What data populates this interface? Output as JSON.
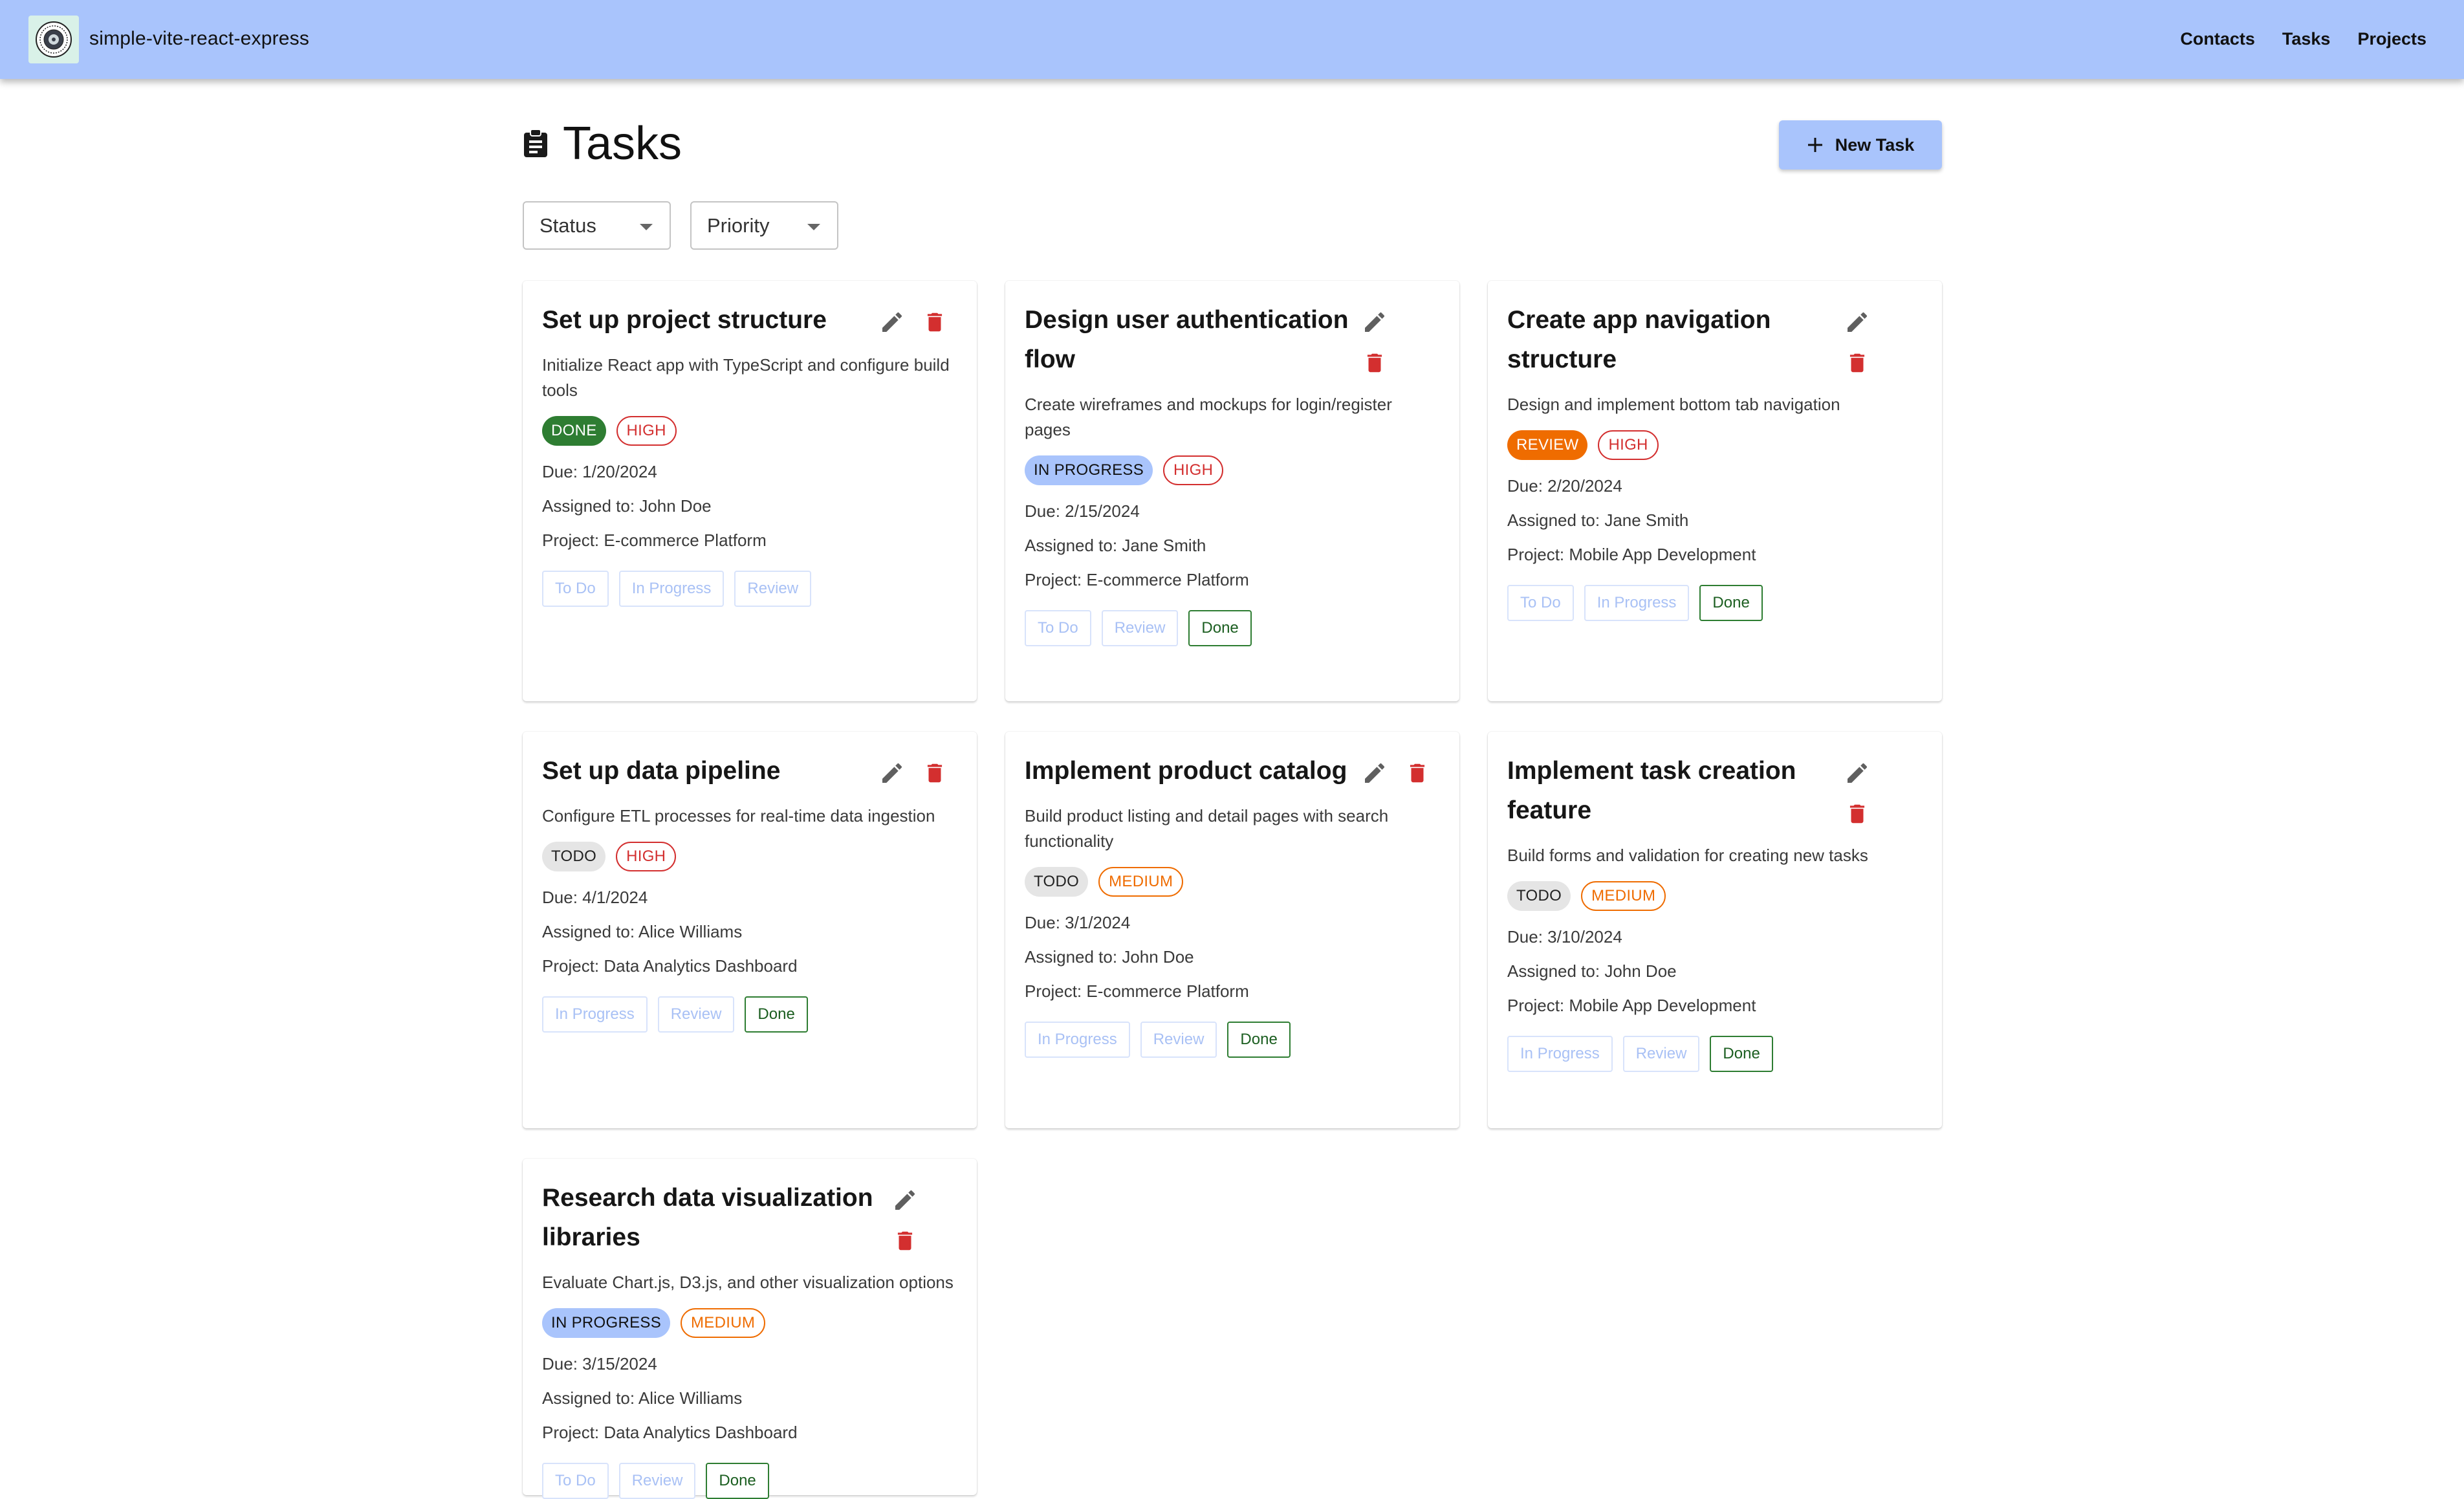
{
  "app": {
    "title": "simple-vite-react-express",
    "logo_icon": "seal-logo"
  },
  "nav": [
    {
      "label": "Contacts"
    },
    {
      "label": "Tasks"
    },
    {
      "label": "Projects"
    }
  ],
  "page": {
    "title": "Tasks",
    "title_icon": "clipboard-icon",
    "new_button": "New Task"
  },
  "filters": {
    "status": "Status",
    "priority": "Priority"
  },
  "colors": {
    "appbar": "#a9c4fc",
    "done": "#2e7d32",
    "review": "#ef6c00",
    "high": "#d32f2f",
    "medium": "#ef6c00",
    "delete": "#d32f2f"
  },
  "tasks": [
    {
      "title": "Set up project structure",
      "description": "Initialize React app with TypeScript and configure build tools",
      "status": "DONE",
      "priority": "HIGH",
      "due": "Due: 1/20/2024",
      "assigned": "Assigned to: John Doe",
      "project": "Project: E-commerce Platform",
      "actions": [
        "To Do",
        "In Progress",
        "Review"
      ]
    },
    {
      "title": "Design user authentication flow",
      "description": "Create wireframes and mockups for login/register pages",
      "status": "IN PROGRESS",
      "priority": "HIGH",
      "due": "Due: 2/15/2024",
      "assigned": "Assigned to: Jane Smith",
      "project": "Project: E-commerce Platform",
      "actions": [
        "To Do",
        "Review",
        "Done"
      ]
    },
    {
      "title": "Create app navigation structure",
      "description": "Design and implement bottom tab navigation",
      "status": "REVIEW",
      "priority": "HIGH",
      "due": "Due: 2/20/2024",
      "assigned": "Assigned to: Jane Smith",
      "project": "Project: Mobile App Development",
      "actions": [
        "To Do",
        "In Progress",
        "Done"
      ]
    },
    {
      "title": "Set up data pipeline",
      "description": "Configure ETL processes for real-time data ingestion",
      "status": "TODO",
      "priority": "HIGH",
      "due": "Due: 4/1/2024",
      "assigned": "Assigned to: Alice Williams",
      "project": "Project: Data Analytics Dashboard",
      "actions": [
        "In Progress",
        "Review",
        "Done"
      ]
    },
    {
      "title": "Implement product catalog",
      "description": "Build product listing and detail pages with search functionality",
      "status": "TODO",
      "priority": "MEDIUM",
      "due": "Due: 3/1/2024",
      "assigned": "Assigned to: John Doe",
      "project": "Project: E-commerce Platform",
      "actions": [
        "In Progress",
        "Review",
        "Done"
      ]
    },
    {
      "title": "Implement task creation feature",
      "description": "Build forms and validation for creating new tasks",
      "status": "TODO",
      "priority": "MEDIUM",
      "due": "Due: 3/10/2024",
      "assigned": "Assigned to: John Doe",
      "project": "Project: Mobile App Development",
      "actions": [
        "In Progress",
        "Review",
        "Done"
      ]
    },
    {
      "title": "Research data visualization libraries",
      "description": "Evaluate Chart.js, D3.js, and other visualization options",
      "status": "IN PROGRESS",
      "priority": "MEDIUM",
      "due": "Due: 3/15/2024",
      "assigned": "Assigned to: Alice Williams",
      "project": "Project: Data Analytics Dashboard",
      "actions": [
        "To Do",
        "Review",
        "Done"
      ]
    }
  ]
}
